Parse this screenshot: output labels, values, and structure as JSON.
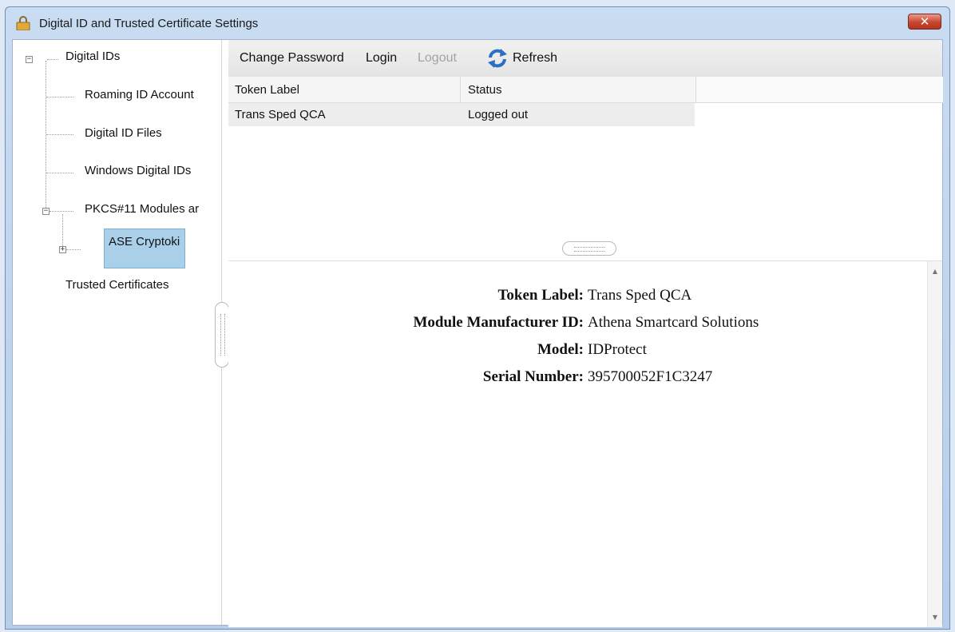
{
  "window": {
    "title": "Digital ID and Trusted Certificate Settings",
    "close_glyph": "✕"
  },
  "tree": {
    "root_label": "Digital IDs",
    "items": {
      "roaming": "Roaming ID Account",
      "files": "Digital ID Files",
      "windows": "Windows Digital IDs",
      "pkcs": "PKCS#11 Modules ar",
      "ase": "ASE Cryptoki",
      "trusted": "Trusted Certificates"
    },
    "collapse_glyph": "−",
    "expand_glyph": "+"
  },
  "toolbar": {
    "change_password": "Change Password",
    "login": "Login",
    "logout": "Logout",
    "refresh": "Refresh"
  },
  "table": {
    "columns": [
      "Token Label",
      "Status"
    ],
    "rows": [
      {
        "token_label": "Trans Sped QCA",
        "status": "Logged out"
      }
    ]
  },
  "details": {
    "token_label": {
      "label": "Token Label:",
      "value": "Trans Sped QCA"
    },
    "manufacturer": {
      "label": "Module Manufacturer ID:",
      "value": "Athena Smartcard Solutions"
    },
    "model": {
      "label": "Model:",
      "value": "IDProtect"
    },
    "serial": {
      "label": "Serial Number:",
      "value": "395700052F1C3247"
    }
  },
  "scroll": {
    "up": "▲",
    "down": "▼"
  },
  "colors": {
    "selection": "#a9cfe9",
    "close_button": "#c8452f",
    "refresh_icon": "#2d6fc4"
  },
  "icons": {
    "title": "lock-icon",
    "refresh": "refresh-icon"
  }
}
